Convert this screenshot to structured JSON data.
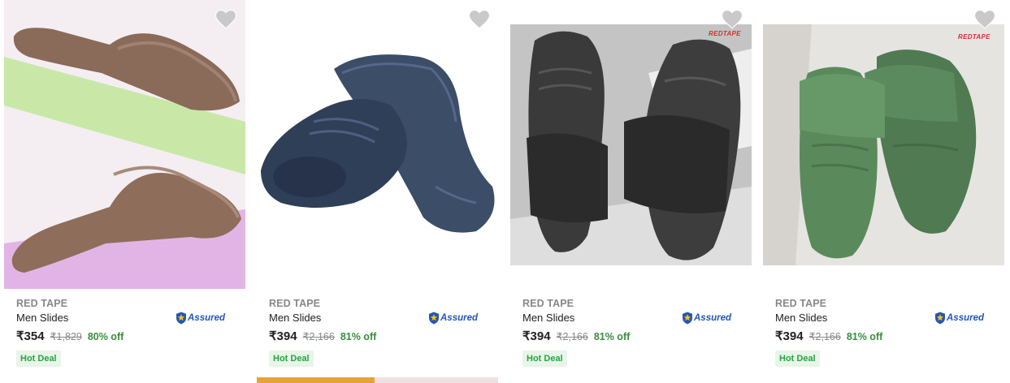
{
  "products": [
    {
      "brand": "RED TAPE",
      "title": "Men Slides",
      "assured_text": "Assured",
      "price": "₹354",
      "mrp": "₹1,829",
      "discount": "80% off",
      "badge": "Hot Deal",
      "wishlist_icon": "heart-icon",
      "logo_text": ""
    },
    {
      "brand": "RED TAPE",
      "title": "Men Slides",
      "assured_text": "Assured",
      "price": "₹394",
      "mrp": "₹2,166",
      "discount": "81% off",
      "badge": "Hot Deal",
      "wishlist_icon": "heart-icon",
      "logo_text": ""
    },
    {
      "brand": "RED TAPE",
      "title": "Men Slides",
      "assured_text": "Assured",
      "price": "₹394",
      "mrp": "₹2,166",
      "discount": "81% off",
      "badge": "Hot Deal",
      "wishlist_icon": "heart-icon",
      "logo_text": "REDTAPE"
    },
    {
      "brand": "RED TAPE",
      "title": "Men Slides",
      "assured_text": "Assured",
      "price": "₹394",
      "mrp": "₹2,166",
      "discount": "81% off",
      "badge": "Hot Deal",
      "wishlist_icon": "heart-icon",
      "logo_text": "REDTAPE"
    }
  ],
  "colors": {
    "price_discount": "#388e3c",
    "hot_deal_text": "#26a541",
    "hot_deal_bg": "#e8f5e9",
    "assured_blue": "#2455b7",
    "brand_gray": "#878787"
  }
}
